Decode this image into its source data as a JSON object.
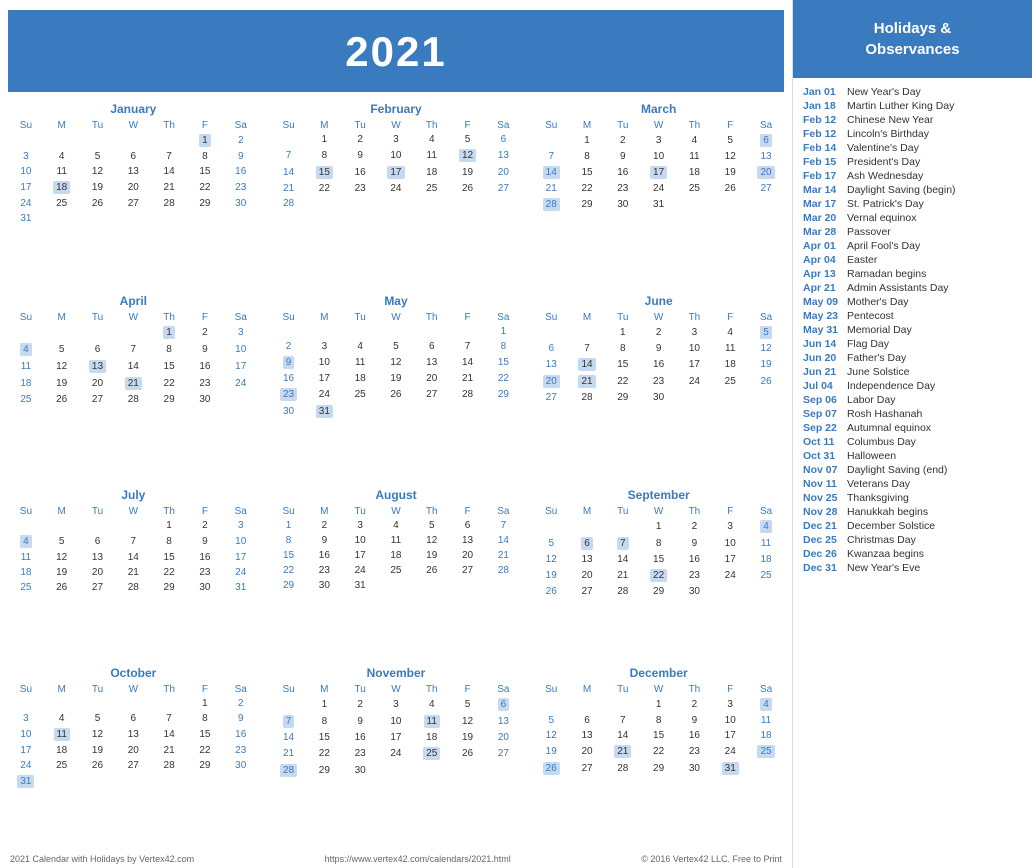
{
  "header": {
    "year": "2021"
  },
  "sidebar_header": "Holidays &\nObservances",
  "footer": {
    "left": "2021 Calendar with Holidays by Vertex42.com",
    "center": "https://www.vertex42.com/calendars/2021.html",
    "right": "© 2016 Vertex42 LLC. Free to Print"
  },
  "holidays": [
    {
      "date": "Jan 01",
      "name": "New Year's Day"
    },
    {
      "date": "Jan 18",
      "name": "Martin Luther King Day"
    },
    {
      "date": "Feb 12",
      "name": "Chinese New Year"
    },
    {
      "date": "Feb 12",
      "name": "Lincoln's Birthday"
    },
    {
      "date": "Feb 14",
      "name": "Valentine's Day"
    },
    {
      "date": "Feb 15",
      "name": "President's Day"
    },
    {
      "date": "Feb 17",
      "name": "Ash Wednesday"
    },
    {
      "date": "Mar 14",
      "name": "Daylight Saving (begin)"
    },
    {
      "date": "Mar 17",
      "name": "St. Patrick's Day"
    },
    {
      "date": "Mar 20",
      "name": "Vernal equinox"
    },
    {
      "date": "Mar 28",
      "name": "Passover"
    },
    {
      "date": "Apr 01",
      "name": "April Fool's Day"
    },
    {
      "date": "Apr 04",
      "name": "Easter"
    },
    {
      "date": "Apr 13",
      "name": "Ramadan begins"
    },
    {
      "date": "Apr 21",
      "name": "Admin Assistants Day"
    },
    {
      "date": "May 09",
      "name": "Mother's Day"
    },
    {
      "date": "May 23",
      "name": "Pentecost"
    },
    {
      "date": "May 31",
      "name": "Memorial Day"
    },
    {
      "date": "Jun 14",
      "name": "Flag Day"
    },
    {
      "date": "Jun 20",
      "name": "Father's Day"
    },
    {
      "date": "Jun 21",
      "name": "June Solstice"
    },
    {
      "date": "Jul 04",
      "name": "Independence Day"
    },
    {
      "date": "Sep 06",
      "name": "Labor Day"
    },
    {
      "date": "Sep 07",
      "name": "Rosh Hashanah"
    },
    {
      "date": "Sep 22",
      "name": "Autumnal equinox"
    },
    {
      "date": "Oct 11",
      "name": "Columbus Day"
    },
    {
      "date": "Oct 31",
      "name": "Halloween"
    },
    {
      "date": "Nov 07",
      "name": "Daylight Saving (end)"
    },
    {
      "date": "Nov 11",
      "name": "Veterans Day"
    },
    {
      "date": "Nov 25",
      "name": "Thanksgiving"
    },
    {
      "date": "Nov 28",
      "name": "Hanukkah begins"
    },
    {
      "date": "Dec 21",
      "name": "December Solstice"
    },
    {
      "date": "Dec 25",
      "name": "Christmas Day"
    },
    {
      "date": "Dec 26",
      "name": "Kwanzaa begins"
    },
    {
      "date": "Dec 31",
      "name": "New Year's Eve"
    }
  ],
  "months": [
    {
      "name": "January",
      "weeks": [
        [
          "",
          "",
          "",
          "",
          "",
          "1",
          "2"
        ],
        [
          "3",
          "4",
          "5",
          "6",
          "7",
          "8",
          "9"
        ],
        [
          "10",
          "11",
          "12",
          "13",
          "14",
          "15",
          "16"
        ],
        [
          "17",
          "18",
          "19",
          "20",
          "21",
          "22",
          "23"
        ],
        [
          "24",
          "25",
          "26",
          "27",
          "28",
          "29",
          "30"
        ],
        [
          "31",
          "",
          "",
          "",
          "",
          "",
          ""
        ]
      ],
      "highlights": [
        "1",
        "18"
      ]
    },
    {
      "name": "February",
      "weeks": [
        [
          "",
          "1",
          "2",
          "3",
          "4",
          "5",
          "6"
        ],
        [
          "7",
          "8",
          "9",
          "10",
          "11",
          "12",
          "13"
        ],
        [
          "14",
          "15",
          "16",
          "17",
          "18",
          "19",
          "20"
        ],
        [
          "21",
          "22",
          "23",
          "24",
          "25",
          "26",
          "27"
        ],
        [
          "28",
          "",
          "",
          "",
          "",
          "",
          ""
        ]
      ],
      "highlights": [
        "12",
        "15",
        "17"
      ]
    },
    {
      "name": "March",
      "weeks": [
        [
          "",
          "1",
          "2",
          "3",
          "4",
          "5",
          "6"
        ],
        [
          "7",
          "8",
          "9",
          "10",
          "11",
          "12",
          "13"
        ],
        [
          "14",
          "15",
          "16",
          "17",
          "18",
          "19",
          "20"
        ],
        [
          "21",
          "22",
          "23",
          "24",
          "25",
          "26",
          "27"
        ],
        [
          "28",
          "29",
          "30",
          "31",
          "",
          "",
          ""
        ]
      ],
      "highlights": [
        "6",
        "14",
        "17",
        "20",
        "28"
      ]
    },
    {
      "name": "April",
      "weeks": [
        [
          "",
          "",
          "",
          "",
          "1",
          "2",
          "3"
        ],
        [
          "4",
          "5",
          "6",
          "7",
          "8",
          "9",
          "10"
        ],
        [
          "11",
          "12",
          "13",
          "14",
          "15",
          "16",
          "17"
        ],
        [
          "18",
          "19",
          "20",
          "21",
          "22",
          "23",
          "24"
        ],
        [
          "25",
          "26",
          "27",
          "28",
          "29",
          "30",
          ""
        ]
      ],
      "highlights": [
        "1",
        "4",
        "13",
        "21"
      ]
    },
    {
      "name": "May",
      "weeks": [
        [
          "",
          "",
          "",
          "",
          "",
          "",
          "1"
        ],
        [
          "2",
          "3",
          "4",
          "5",
          "6",
          "7",
          "8"
        ],
        [
          "9",
          "10",
          "11",
          "12",
          "13",
          "14",
          "15"
        ],
        [
          "16",
          "17",
          "18",
          "19",
          "20",
          "21",
          "22"
        ],
        [
          "23",
          "24",
          "25",
          "26",
          "27",
          "28",
          "29"
        ],
        [
          "30",
          "31",
          "",
          "",
          "",
          "",
          ""
        ]
      ],
      "highlights": [
        "9",
        "23",
        "31"
      ]
    },
    {
      "name": "June",
      "weeks": [
        [
          "",
          "",
          "1",
          "2",
          "3",
          "4",
          "5"
        ],
        [
          "6",
          "7",
          "8",
          "9",
          "10",
          "11",
          "12"
        ],
        [
          "13",
          "14",
          "15",
          "16",
          "17",
          "18",
          "19"
        ],
        [
          "20",
          "21",
          "22",
          "23",
          "24",
          "25",
          "26"
        ],
        [
          "27",
          "28",
          "29",
          "30",
          "",
          "",
          ""
        ]
      ],
      "highlights": [
        "5",
        "14",
        "20",
        "21"
      ]
    },
    {
      "name": "July",
      "weeks": [
        [
          "",
          "",
          "",
          "",
          "1",
          "2",
          "3"
        ],
        [
          "4",
          "5",
          "6",
          "7",
          "8",
          "9",
          "10"
        ],
        [
          "11",
          "12",
          "13",
          "14",
          "15",
          "16",
          "17"
        ],
        [
          "18",
          "19",
          "20",
          "21",
          "22",
          "23",
          "24"
        ],
        [
          "25",
          "26",
          "27",
          "28",
          "29",
          "30",
          "31"
        ]
      ],
      "highlights": [
        "4"
      ]
    },
    {
      "name": "August",
      "weeks": [
        [
          "1",
          "2",
          "3",
          "4",
          "5",
          "6",
          "7"
        ],
        [
          "8",
          "9",
          "10",
          "11",
          "12",
          "13",
          "14"
        ],
        [
          "15",
          "16",
          "17",
          "18",
          "19",
          "20",
          "21"
        ],
        [
          "22",
          "23",
          "24",
          "25",
          "26",
          "27",
          "28"
        ],
        [
          "29",
          "30",
          "31",
          "",
          "",
          "",
          ""
        ]
      ],
      "highlights": []
    },
    {
      "name": "September",
      "weeks": [
        [
          "",
          "",
          "",
          "1",
          "2",
          "3",
          "4"
        ],
        [
          "5",
          "6",
          "7",
          "8",
          "9",
          "10",
          "11"
        ],
        [
          "12",
          "13",
          "14",
          "15",
          "16",
          "17",
          "18"
        ],
        [
          "19",
          "20",
          "21",
          "22",
          "23",
          "24",
          "25"
        ],
        [
          "26",
          "27",
          "28",
          "29",
          "30",
          "",
          ""
        ]
      ],
      "highlights": [
        "4",
        "6",
        "7",
        "22"
      ]
    },
    {
      "name": "October",
      "weeks": [
        [
          "",
          "",
          "",
          "",
          "",
          "1",
          "2"
        ],
        [
          "3",
          "4",
          "5",
          "6",
          "7",
          "8",
          "9"
        ],
        [
          "10",
          "11",
          "12",
          "13",
          "14",
          "15",
          "16"
        ],
        [
          "17",
          "18",
          "19",
          "20",
          "21",
          "22",
          "23"
        ],
        [
          "24",
          "25",
          "26",
          "27",
          "28",
          "29",
          "30"
        ],
        [
          "31",
          "",
          "",
          "",
          "",
          "",
          ""
        ]
      ],
      "highlights": [
        "11",
        "31"
      ]
    },
    {
      "name": "November",
      "weeks": [
        [
          "",
          "1",
          "2",
          "3",
          "4",
          "5",
          "6"
        ],
        [
          "7",
          "8",
          "9",
          "10",
          "11",
          "12",
          "13"
        ],
        [
          "14",
          "15",
          "16",
          "17",
          "18",
          "19",
          "20"
        ],
        [
          "21",
          "22",
          "23",
          "24",
          "25",
          "26",
          "27"
        ],
        [
          "28",
          "29",
          "30",
          "",
          "",
          "",
          ""
        ]
      ],
      "highlights": [
        "6",
        "7",
        "11",
        "25",
        "28"
      ]
    },
    {
      "name": "December",
      "weeks": [
        [
          "",
          "",
          "",
          "1",
          "2",
          "3",
          "4"
        ],
        [
          "5",
          "6",
          "7",
          "8",
          "9",
          "10",
          "11"
        ],
        [
          "12",
          "13",
          "14",
          "15",
          "16",
          "17",
          "18"
        ],
        [
          "19",
          "20",
          "21",
          "22",
          "23",
          "24",
          "25"
        ],
        [
          "26",
          "27",
          "28",
          "29",
          "30",
          "31",
          ""
        ]
      ],
      "highlights": [
        "4",
        "21",
        "25",
        "26",
        "31"
      ]
    }
  ]
}
